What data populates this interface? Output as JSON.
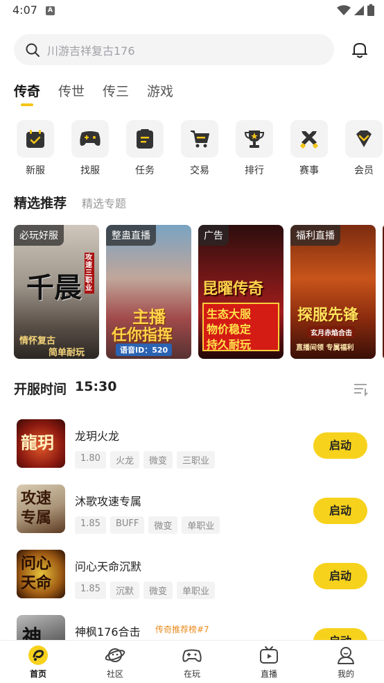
{
  "status_bar": {
    "time": "4:07",
    "notif_letter": "A"
  },
  "search": {
    "placeholder": "川游吉祥复古176"
  },
  "tabs": [
    {
      "label": "传奇",
      "active": true
    },
    {
      "label": "传世",
      "active": false
    },
    {
      "label": "传三",
      "active": false
    },
    {
      "label": "游戏",
      "active": false
    }
  ],
  "categories": [
    {
      "label": "新服",
      "icon": "calendar-check-icon"
    },
    {
      "label": "找服",
      "icon": "gamepad-icon"
    },
    {
      "label": "任务",
      "icon": "task-list-icon"
    },
    {
      "label": "交易",
      "icon": "shopping-cart-icon"
    },
    {
      "label": "排行",
      "icon": "trophy-icon"
    },
    {
      "label": "赛事",
      "icon": "crossed-swords-icon"
    },
    {
      "label": "会员",
      "icon": "vip-diamond-icon"
    }
  ],
  "featured": {
    "title": "精选推荐",
    "alt_tab": "精选专题"
  },
  "banners": [
    {
      "tag": "必玩好服",
      "headline": "千晨",
      "side_text": "攻速三职业",
      "line1": "情怀复古",
      "line2": "简单耐玩"
    },
    {
      "tag": "整蛊直播",
      "headline1": "主播",
      "headline2": "任你指挥",
      "voice": "语音ID：520"
    },
    {
      "tag": "广告",
      "headline": "昆曜传奇",
      "lines": [
        "生态大服",
        "物价稳定",
        "持久耐玩"
      ]
    },
    {
      "tag": "福利直播",
      "headline": "探服先锋",
      "sub1": "玄月赤焰合击",
      "sub2": "直播间领 专属福利"
    }
  ],
  "open_time": {
    "label": "开服时间",
    "time": "15:30"
  },
  "games": [
    {
      "name": "龙玥火龙",
      "tags": [
        "1.80",
        "火龙",
        "微变",
        "三职业"
      ],
      "button": "启动",
      "thumb_text": "龍玥"
    },
    {
      "name": "沐歌攻速专属",
      "tags": [
        "1.85",
        "BUFF",
        "微变",
        "单职业"
      ],
      "button": "启动",
      "thumb_text": "攻速专属"
    },
    {
      "name": "问心天命沉默",
      "tags": [
        "1.85",
        "沉默",
        "微变",
        "单职业"
      ],
      "button": "启动",
      "thumb_text": "问心天命"
    },
    {
      "name": "神枫176合击",
      "rank": "传奇推荐榜#7",
      "tags": [],
      "button": "启动",
      "thumb_text": "神"
    }
  ],
  "bottom_nav": [
    {
      "label": "首页",
      "active": true
    },
    {
      "label": "社区",
      "active": false
    },
    {
      "label": "在玩",
      "active": false
    },
    {
      "label": "直播",
      "active": false
    },
    {
      "label": "我的",
      "active": false
    }
  ],
  "colors": {
    "accent": "#f7d21c",
    "tab_underline": "#f5c518",
    "rank_text": "#e98a1c"
  }
}
